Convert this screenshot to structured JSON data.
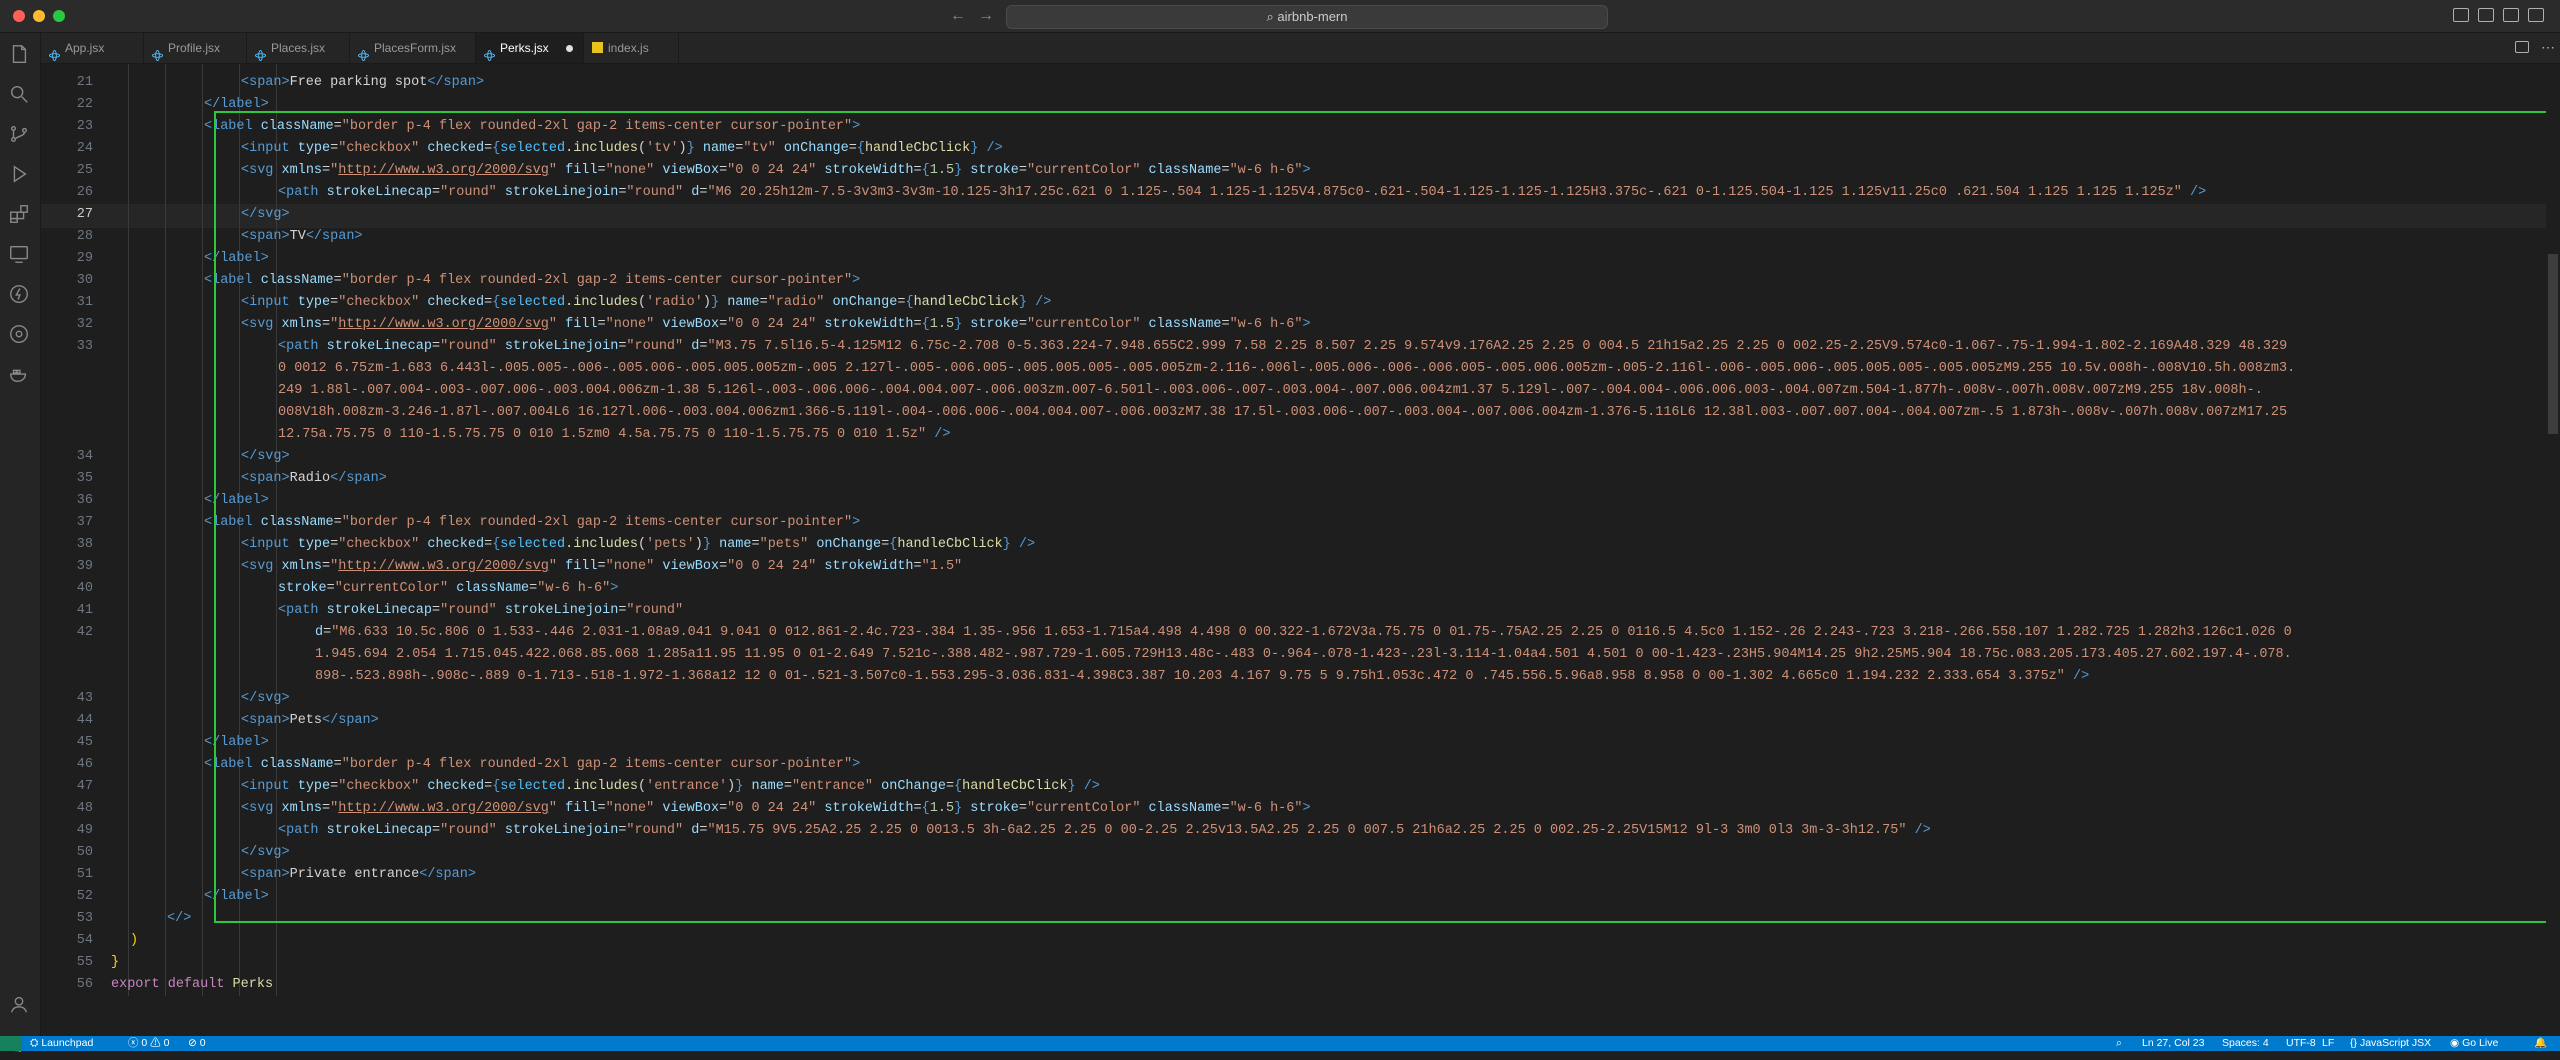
{
  "window": {
    "title": "airbnb-mern"
  },
  "tabs": [
    {
      "label": "App.jsx",
      "icon": "react-icon",
      "active": false
    },
    {
      "label": "Profile.jsx",
      "icon": "react-icon",
      "active": false
    },
    {
      "label": "Places.jsx",
      "icon": "react-icon",
      "active": false
    },
    {
      "label": "PlacesForm.jsx",
      "icon": "react-icon",
      "active": false
    },
    {
      "label": "Perks.jsx",
      "icon": "react-icon",
      "active": true,
      "modified": true
    },
    {
      "label": "index.js",
      "icon": "js-icon",
      "active": false
    }
  ],
  "editor": {
    "current_line": 27,
    "lines": [
      {
        "n": "21",
        "indent": 4,
        "html": "<span class=\"t\">&lt;span&gt;</span>Free parking spot<span class=\"t\">&lt;/span&gt;</span>"
      },
      {
        "n": "22",
        "indent": 3,
        "html": "<span class=\"t\">&lt;/label&gt;</span>"
      },
      {
        "n": "23",
        "indent": 3,
        "html": "<span class=\"t\">&lt;label</span> <span class=\"a\">className</span>=<span class=\"s\">\"border p-4 flex rounded-2xl gap-2 items-center cursor-pointer\"</span><span class=\"t\">&gt;</span>"
      },
      {
        "n": "24",
        "indent": 4,
        "html": "<span class=\"t\">&lt;input</span> <span class=\"a\">type</span>=<span class=\"s\">\"checkbox\"</span> <span class=\"a\">checked</span>=<span class=\"t\">{</span><span class=\"v\">selected</span>.<span class=\"f\">includes</span>(<span class=\"s\">'tv'</span>)<span class=\"t\">}</span> <span class=\"a\">name</span>=<span class=\"s\">\"tv\"</span> <span class=\"a\">onChange</span>=<span class=\"t\">{</span><span class=\"f\">handleCbClick</span><span class=\"t\">}</span> <span class=\"t\">/&gt;</span>"
      },
      {
        "n": "25",
        "indent": 4,
        "html": "<span class=\"t\">&lt;svg</span> <span class=\"a\">xmlns</span>=<span class=\"s\">\"</span><span class=\"u\">http://www.w3.org/2000/svg</span><span class=\"s\">\"</span> <span class=\"a\">fill</span>=<span class=\"s\">\"none\"</span> <span class=\"a\">viewBox</span>=<span class=\"s\">\"0 0 24 24\"</span> <span class=\"a\">strokeWidth</span>=<span class=\"t\">{</span><span class=\"n\">1.5</span><span class=\"t\">}</span> <span class=\"a\">stroke</span>=<span class=\"s\">\"currentColor\"</span> <span class=\"a\">className</span>=<span class=\"s\">\"w-6 h-6\"</span><span class=\"t\">&gt;</span>"
      },
      {
        "n": "26",
        "indent": 5,
        "html": "<span class=\"t\">&lt;path</span> <span class=\"a\">strokeLinecap</span>=<span class=\"s\">\"round\"</span> <span class=\"a\">strokeLinejoin</span>=<span class=\"s\">\"round\"</span> <span class=\"a\">d</span>=<span class=\"s\">\"M6 20.25h12m-7.5-3v3m3-3v3m-10.125-3h17.25c.621 0 1.125-.504 1.125-1.125V4.875c0-.621-.504-1.125-1.125-1.125H3.375c-.621 0-1.125.504-1.125 1.125v11.25c0 .621.504 1.125 1.125 1.125z\"</span> <span class=\"t\">/&gt;</span>"
      },
      {
        "n": "27",
        "indent": 4,
        "html": "<span class=\"t\">&lt;/svg&gt;</span>"
      },
      {
        "n": "28",
        "indent": 4,
        "html": "<span class=\"t\">&lt;span&gt;</span>TV<span class=\"t\">&lt;/span&gt;</span>"
      },
      {
        "n": "29",
        "indent": 3,
        "html": "<span class=\"t\">&lt;/label&gt;</span>"
      },
      {
        "n": "30",
        "indent": 3,
        "html": "<span class=\"t\">&lt;label</span> <span class=\"a\">className</span>=<span class=\"s\">\"border p-4 flex rounded-2xl gap-2 items-center cursor-pointer\"</span><span class=\"t\">&gt;</span>"
      },
      {
        "n": "31",
        "indent": 4,
        "html": "<span class=\"t\">&lt;input</span> <span class=\"a\">type</span>=<span class=\"s\">\"checkbox\"</span> <span class=\"a\">checked</span>=<span class=\"t\">{</span><span class=\"v\">selected</span>.<span class=\"f\">includes</span>(<span class=\"s\">'radio'</span>)<span class=\"t\">}</span> <span class=\"a\">name</span>=<span class=\"s\">\"radio\"</span> <span class=\"a\">onChange</span>=<span class=\"t\">{</span><span class=\"f\">handleCbClick</span><span class=\"t\">}</span> <span class=\"t\">/&gt;</span>"
      },
      {
        "n": "32",
        "indent": 4,
        "html": "<span class=\"t\">&lt;svg</span> <span class=\"a\">xmlns</span>=<span class=\"s\">\"</span><span class=\"u\">http://www.w3.org/2000/svg</span><span class=\"s\">\"</span> <span class=\"a\">fill</span>=<span class=\"s\">\"none\"</span> <span class=\"a\">viewBox</span>=<span class=\"s\">\"0 0 24 24\"</span> <span class=\"a\">strokeWidth</span>=<span class=\"t\">{</span><span class=\"n\">1.5</span><span class=\"t\">}</span> <span class=\"a\">stroke</span>=<span class=\"s\">\"currentColor\"</span> <span class=\"a\">className</span>=<span class=\"s\">\"w-6 h-6\"</span><span class=\"t\">&gt;</span>"
      },
      {
        "n": "33",
        "indent": 5,
        "html": "<span class=\"t\">&lt;path</span> <span class=\"a\">strokeLinecap</span>=<span class=\"s\">\"round\"</span> <span class=\"a\">strokeLinejoin</span>=<span class=\"s\">\"round\"</span> <span class=\"a\">d</span>=<span class=\"s\">\"M3.75 7.5l16.5-4.125M12 6.75c-2.708 0-5.363.224-7.948.655C2.999 7.58 2.25 8.507 2.25 9.574v9.176A2.25 2.25 0 004.5 21h15a2.25 2.25 0 002.25-2.25V9.574c0-1.067-.75-1.994-1.802-2.169A48.329 48.329</span>"
      },
      {
        "n": "",
        "indent": 5,
        "html": "<span class=\"s\">0 0012 6.75zm-1.683 6.443l-.005.005-.006-.005.006-.005.005.005zm-.005 2.127l-.005-.006.005-.005.005.005-.005.005zm-2.116-.006l-.005.006-.006-.006.005-.005.006.005zm-.005-2.116l-.006-.005.006-.005.005.005-.005.005zM9.255 10.5v.008h-.008V10.5h.008zm3.</span>"
      },
      {
        "n": "",
        "indent": 5,
        "html": "<span class=\"s\">249 1.88l-.007.004-.003-.007.006-.003.004.006zm-1.38 5.126l-.003-.006.006-.004.004.007-.006.003zm.007-6.501l-.003.006-.007-.003.004-.007.006.004zm1.37 5.129l-.007-.004.004-.006.006.003-.004.007zm.504-1.877h-.008v-.007h.008v.007zM9.255 18v.008h-.</span>"
      },
      {
        "n": "",
        "indent": 5,
        "html": "<span class=\"s\">008V18h.008zm-3.246-1.87l-.007.004L6 16.127l.006-.003.004.006zm1.366-5.119l-.004-.006.006-.004.004.007-.006.003zM7.38 17.5l-.003.006-.007-.003.004-.007.006.004zm-1.376-5.116L6 12.38l.003-.007.007.004-.004.007zm-.5 1.873h-.008v-.007h.008v.007zM17.25</span>"
      },
      {
        "n": "",
        "indent": 5,
        "html": "<span class=\"s\">12.75a.75.75 0 110-1.5.75.75 0 010 1.5zm0 4.5a.75.75 0 110-1.5.75.75 0 010 1.5z\"</span> <span class=\"t\">/&gt;</span>"
      },
      {
        "n": "34",
        "indent": 4,
        "html": "<span class=\"t\">&lt;/svg&gt;</span>"
      },
      {
        "n": "35",
        "indent": 4,
        "html": "<span class=\"t\">&lt;span&gt;</span>Radio<span class=\"t\">&lt;/span&gt;</span>"
      },
      {
        "n": "36",
        "indent": 3,
        "html": "<span class=\"t\">&lt;/label&gt;</span>"
      },
      {
        "n": "37",
        "indent": 3,
        "html": "<span class=\"t\">&lt;label</span> <span class=\"a\">className</span>=<span class=\"s\">\"border p-4 flex rounded-2xl gap-2 items-center cursor-pointer\"</span><span class=\"t\">&gt;</span>"
      },
      {
        "n": "38",
        "indent": 4,
        "html": "<span class=\"t\">&lt;input</span> <span class=\"a\">type</span>=<span class=\"s\">\"checkbox\"</span> <span class=\"a\">checked</span>=<span class=\"t\">{</span><span class=\"v\">selected</span>.<span class=\"f\">includes</span>(<span class=\"s\">'pets'</span>)<span class=\"t\">}</span> <span class=\"a\">name</span>=<span class=\"s\">\"pets\"</span> <span class=\"a\">onChange</span>=<span class=\"t\">{</span><span class=\"f\">handleCbClick</span><span class=\"t\">}</span> <span class=\"t\">/&gt;</span>"
      },
      {
        "n": "39",
        "indent": 4,
        "html": "<span class=\"t\">&lt;svg</span> <span class=\"a\">xmlns</span>=<span class=\"s\">\"</span><span class=\"u\">http://www.w3.org/2000/svg</span><span class=\"s\">\"</span> <span class=\"a\">fill</span>=<span class=\"s\">\"none\"</span> <span class=\"a\">viewBox</span>=<span class=\"s\">\"0 0 24 24\"</span> <span class=\"a\">strokeWidth</span>=<span class=\"s\">\"1.5\"</span>"
      },
      {
        "n": "40",
        "indent": 5,
        "html": "<span class=\"a\">stroke</span>=<span class=\"s\">\"currentColor\"</span> <span class=\"a\">className</span>=<span class=\"s\">\"w-6 h-6\"</span><span class=\"t\">&gt;</span>"
      },
      {
        "n": "41",
        "indent": 5,
        "html": "<span class=\"t\">&lt;path</span> <span class=\"a\">strokeLinecap</span>=<span class=\"s\">\"round\"</span> <span class=\"a\">strokeLinejoin</span>=<span class=\"s\">\"round\"</span>"
      },
      {
        "n": "42",
        "indent": 6,
        "html": "<span class=\"a\">d</span>=<span class=\"s\">\"M6.633 10.5c.806 0 1.533-.446 2.031-1.08a9.041 9.041 0 012.861-2.4c.723-.384 1.35-.956 1.653-1.715a4.498 4.498 0 00.322-1.672V3a.75.75 0 01.75-.75A2.25 2.25 0 0116.5 4.5c0 1.152-.26 2.243-.723 3.218-.266.558.107 1.282.725 1.282h3.126c1.026 0</span>"
      },
      {
        "n": "",
        "indent": 6,
        "html": "<span class=\"s\">1.945.694 2.054 1.715.045.422.068.85.068 1.285a11.95 11.95 0 01-2.649 7.521c-.388.482-.987.729-1.605.729H13.48c-.483 0-.964-.078-1.423-.23l-3.114-1.04a4.501 4.501 0 00-1.423-.23H5.904M14.25 9h2.25M5.904 18.75c.083.205.173.405.27.602.197.4-.078.</span>"
      },
      {
        "n": "",
        "indent": 6,
        "html": "<span class=\"s\">898-.523.898h-.908c-.889 0-1.713-.518-1.972-1.368a12 12 0 01-.521-3.507c0-1.553.295-3.036.831-4.398C3.387 10.203 4.167 9.75 5 9.75h1.053c.472 0 .745.556.5.96a8.958 8.958 0 00-1.302 4.665c0 1.194.232 2.333.654 3.375z\"</span> <span class=\"t\">/&gt;</span>"
      },
      {
        "n": "43",
        "indent": 4,
        "html": "<span class=\"t\">&lt;/svg&gt;</span>"
      },
      {
        "n": "44",
        "indent": 4,
        "html": "<span class=\"t\">&lt;span&gt;</span>Pets<span class=\"t\">&lt;/span&gt;</span>"
      },
      {
        "n": "45",
        "indent": 3,
        "html": "<span class=\"t\">&lt;/label&gt;</span>"
      },
      {
        "n": "46",
        "indent": 3,
        "html": "<span class=\"t\">&lt;label</span> <span class=\"a\">className</span>=<span class=\"s\">\"border p-4 flex rounded-2xl gap-2 items-center cursor-pointer\"</span><span class=\"t\">&gt;</span>"
      },
      {
        "n": "47",
        "indent": 4,
        "html": "<span class=\"t\">&lt;input</span> <span class=\"a\">type</span>=<span class=\"s\">\"checkbox\"</span> <span class=\"a\">checked</span>=<span class=\"t\">{</span><span class=\"v\">selected</span>.<span class=\"f\">includes</span>(<span class=\"s\">'entrance'</span>)<span class=\"t\">}</span> <span class=\"a\">name</span>=<span class=\"s\">\"entrance\"</span> <span class=\"a\">onChange</span>=<span class=\"t\">{</span><span class=\"f\">handleCbClick</span><span class=\"t\">}</span> <span class=\"t\">/&gt;</span>"
      },
      {
        "n": "48",
        "indent": 4,
        "html": "<span class=\"t\">&lt;svg</span> <span class=\"a\">xmlns</span>=<span class=\"s\">\"</span><span class=\"u\">http://www.w3.org/2000/svg</span><span class=\"s\">\"</span> <span class=\"a\">fill</span>=<span class=\"s\">\"none\"</span> <span class=\"a\">viewBox</span>=<span class=\"s\">\"0 0 24 24\"</span> <span class=\"a\">strokeWidth</span>=<span class=\"t\">{</span><span class=\"n\">1.5</span><span class=\"t\">}</span> <span class=\"a\">stroke</span>=<span class=\"s\">\"currentColor\"</span> <span class=\"a\">className</span>=<span class=\"s\">\"w-6 h-6\"</span><span class=\"t\">&gt;</span>"
      },
      {
        "n": "49",
        "indent": 5,
        "html": "<span class=\"t\">&lt;path</span> <span class=\"a\">strokeLinecap</span>=<span class=\"s\">\"round\"</span> <span class=\"a\">strokeLinejoin</span>=<span class=\"s\">\"round\"</span> <span class=\"a\">d</span>=<span class=\"s\">\"M15.75 9V5.25A2.25 2.25 0 0013.5 3h-6a2.25 2.25 0 00-2.25 2.25v13.5A2.25 2.25 0 007.5 21h6a2.25 2.25 0 002.25-2.25V15M12 9l-3 3m0 0l3 3m-3-3h12.75\"</span> <span class=\"t\">/&gt;</span>"
      },
      {
        "n": "50",
        "indent": 4,
        "html": "<span class=\"t\">&lt;/svg&gt;</span>"
      },
      {
        "n": "51",
        "indent": 4,
        "html": "<span class=\"t\">&lt;span&gt;</span>Private entrance<span class=\"t\">&lt;/span&gt;</span>"
      },
      {
        "n": "52",
        "indent": 3,
        "html": "<span class=\"t\">&lt;/label&gt;</span>"
      },
      {
        "n": "53",
        "indent": 2,
        "html": "<span class=\"t\">&lt;/&gt;</span>"
      },
      {
        "n": "54",
        "indent": 1,
        "html": "<span class=\"b\">)</span>"
      },
      {
        "n": "55",
        "indent": 0,
        "html": "<span class=\"b\">}</span>"
      },
      {
        "n": "56",
        "indent": 0,
        "html": "<span class=\"k\">export</span> <span class=\"k\">default</span> <span class=\"f\">Perks</span>"
      }
    ]
  },
  "statusbar": {
    "branch": "Launchpad",
    "errors": "0",
    "warnings": "0",
    "ports": "0",
    "cursor": "Ln 27, Col 23",
    "spaces": "Spaces: 4",
    "encoding": "UTF-8",
    "eol": "LF",
    "language": "JavaScript JSX",
    "golive": "Go Live"
  },
  "colors": {
    "selection_border": "#2ec63a",
    "statusbar": "#007acc",
    "tag": "#569cd6",
    "attr": "#9cdcfe",
    "string": "#ce9178"
  }
}
